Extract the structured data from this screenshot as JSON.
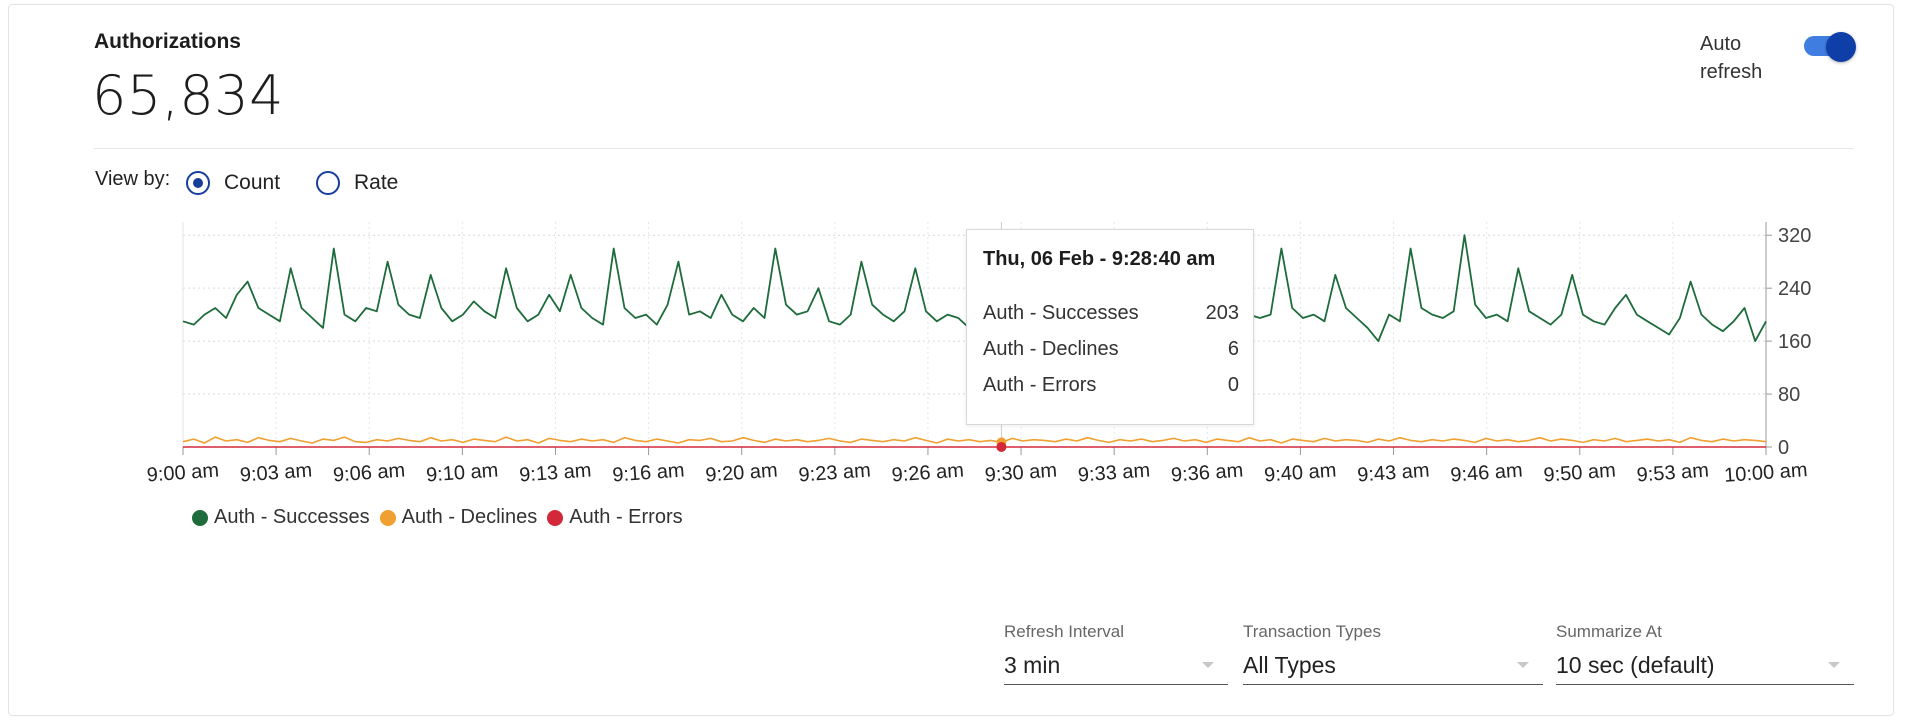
{
  "header": {
    "title": "Authorizations",
    "total": "65,834",
    "auto_refresh_label": "Auto refresh",
    "auto_refresh_on": true
  },
  "view_by": {
    "label": "View by:",
    "options": [
      "Count",
      "Rate"
    ],
    "selected": "Count"
  },
  "chart_data": {
    "type": "line",
    "x": [
      "9:00 am",
      "9:03 am",
      "9:06 am",
      "9:10 am",
      "9:13 am",
      "9:16 am",
      "9:20 am",
      "9:23 am",
      "9:26 am",
      "9:30 am",
      "9:33 am",
      "9:36 am",
      "9:40 am",
      "9:43 am",
      "9:46 am",
      "9:50 am",
      "9:53 am",
      "10:00 am"
    ],
    "ylim": [
      0,
      340
    ],
    "yticks": [
      0,
      80,
      160,
      240,
      320
    ],
    "grid": true,
    "legend_position": "bottom-left",
    "series": [
      {
        "name": "Auth - Successes",
        "color": "#1e6b3c",
        "values": [
          190,
          185,
          200,
          210,
          195,
          230,
          250,
          210,
          200,
          190,
          270,
          210,
          195,
          180,
          300,
          200,
          190,
          210,
          205,
          280,
          215,
          200,
          195,
          260,
          210,
          190,
          200,
          220,
          205,
          195,
          270,
          210,
          190,
          200,
          230,
          205,
          260,
          210,
          195,
          185,
          300,
          210,
          195,
          200,
          185,
          215,
          280,
          200,
          205,
          195,
          230,
          200,
          190,
          210,
          195,
          300,
          215,
          200,
          205,
          240,
          190,
          185,
          200,
          280,
          215,
          200,
          190,
          205,
          270,
          205,
          190,
          200,
          195,
          180,
          210,
          230,
          203,
          200,
          195,
          200,
          190,
          210,
          200,
          195,
          205,
          200,
          190,
          205,
          200,
          195,
          210,
          200,
          190,
          200,
          195,
          205,
          200,
          195,
          210,
          200,
          195,
          200,
          300,
          210,
          195,
          200,
          190,
          260,
          210,
          195,
          180,
          160,
          200,
          190,
          300,
          210,
          200,
          195,
          205,
          320,
          215,
          195,
          200,
          190,
          270,
          205,
          195,
          185,
          200,
          260,
          200,
          190,
          185,
          210,
          230,
          200,
          190,
          180,
          170,
          195,
          250,
          200,
          185,
          175,
          190,
          210,
          160,
          190
        ]
      },
      {
        "name": "Auth - Declines",
        "color": "#f0a030",
        "values": [
          8,
          12,
          6,
          15,
          9,
          11,
          7,
          14,
          10,
          8,
          13,
          9,
          6,
          12,
          10,
          15,
          8,
          7,
          11,
          9,
          13,
          10,
          8,
          14,
          9,
          11,
          7,
          12,
          10,
          8,
          15,
          9,
          11,
          6,
          13,
          10,
          8,
          12,
          9,
          11,
          7,
          14,
          10,
          8,
          12,
          9,
          6,
          11,
          10,
          13,
          8,
          9,
          14,
          10,
          7,
          12,
          9,
          11,
          8,
          10,
          13,
          9,
          7,
          12,
          10,
          8,
          11,
          9,
          14,
          10,
          6,
          12,
          9,
          11,
          8,
          10,
          7,
          13,
          9,
          11,
          10,
          8,
          12,
          9,
          14,
          10,
          7,
          11,
          9,
          12,
          8,
          10,
          13,
          9,
          11,
          7,
          12,
          10,
          8,
          14,
          9,
          11,
          6,
          12,
          10,
          8,
          13,
          9,
          11,
          10,
          7,
          12,
          9,
          14,
          10,
          8,
          11,
          9,
          12,
          10,
          7,
          13,
          9,
          11,
          8,
          10,
          14,
          9,
          12,
          10,
          7,
          11,
          9,
          13,
          8,
          10,
          12,
          9,
          11,
          7,
          14,
          10,
          8,
          12,
          9,
          11,
          10,
          8
        ]
      },
      {
        "name": "Auth - Errors",
        "color": "#d3283a",
        "values": [
          0,
          0,
          0,
          0,
          0,
          0,
          0,
          0,
          0,
          0,
          0,
          0,
          0,
          0,
          0,
          0,
          0,
          0,
          0,
          0,
          0,
          0,
          0,
          0,
          0,
          0,
          0,
          0,
          0,
          0,
          0,
          0,
          0,
          0,
          0,
          0,
          0,
          0,
          0,
          0,
          0,
          0,
          0,
          0,
          0,
          0,
          0,
          0,
          0,
          0,
          0,
          0,
          0,
          0,
          0,
          0,
          0,
          0,
          0,
          0,
          0,
          0,
          0,
          0,
          0,
          0,
          0,
          0,
          0,
          0,
          0,
          0,
          0,
          0,
          0,
          0,
          0,
          0,
          0,
          0,
          0,
          0,
          0,
          0,
          0,
          0,
          0,
          0,
          0,
          0,
          0,
          0,
          0,
          0,
          0,
          0,
          0,
          0,
          0,
          0,
          0,
          0,
          0,
          0,
          0,
          0,
          0,
          0,
          0,
          0,
          0,
          0,
          0,
          0,
          0,
          0,
          0,
          0,
          0,
          0,
          0,
          0,
          0,
          0,
          0,
          0,
          0,
          0,
          0,
          0,
          0,
          0,
          0,
          0,
          0,
          0,
          0,
          0,
          0,
          0,
          0,
          0,
          0,
          0,
          0,
          0,
          0,
          0
        ]
      }
    ],
    "hover_index": 76
  },
  "tooltip": {
    "title": "Thu, 06 Feb - 9:28:40 am",
    "rows": [
      {
        "label": "Auth - Successes",
        "value": "203"
      },
      {
        "label": "Auth - Declines",
        "value": "6"
      },
      {
        "label": "Auth - Errors",
        "value": "0"
      }
    ]
  },
  "legend": [
    {
      "label": "Auth - Successes",
      "color": "#1e6b3c"
    },
    {
      "label": "Auth - Declines",
      "color": "#f0a030"
    },
    {
      "label": "Auth - Errors",
      "color": "#d3283a"
    }
  ],
  "filters": {
    "refresh_interval": {
      "label": "Refresh Interval",
      "value": "3 min"
    },
    "transaction_types": {
      "label": "Transaction Types",
      "value": "All Types"
    },
    "summarize_at": {
      "label": "Summarize At",
      "value": "10 sec (default)"
    }
  }
}
